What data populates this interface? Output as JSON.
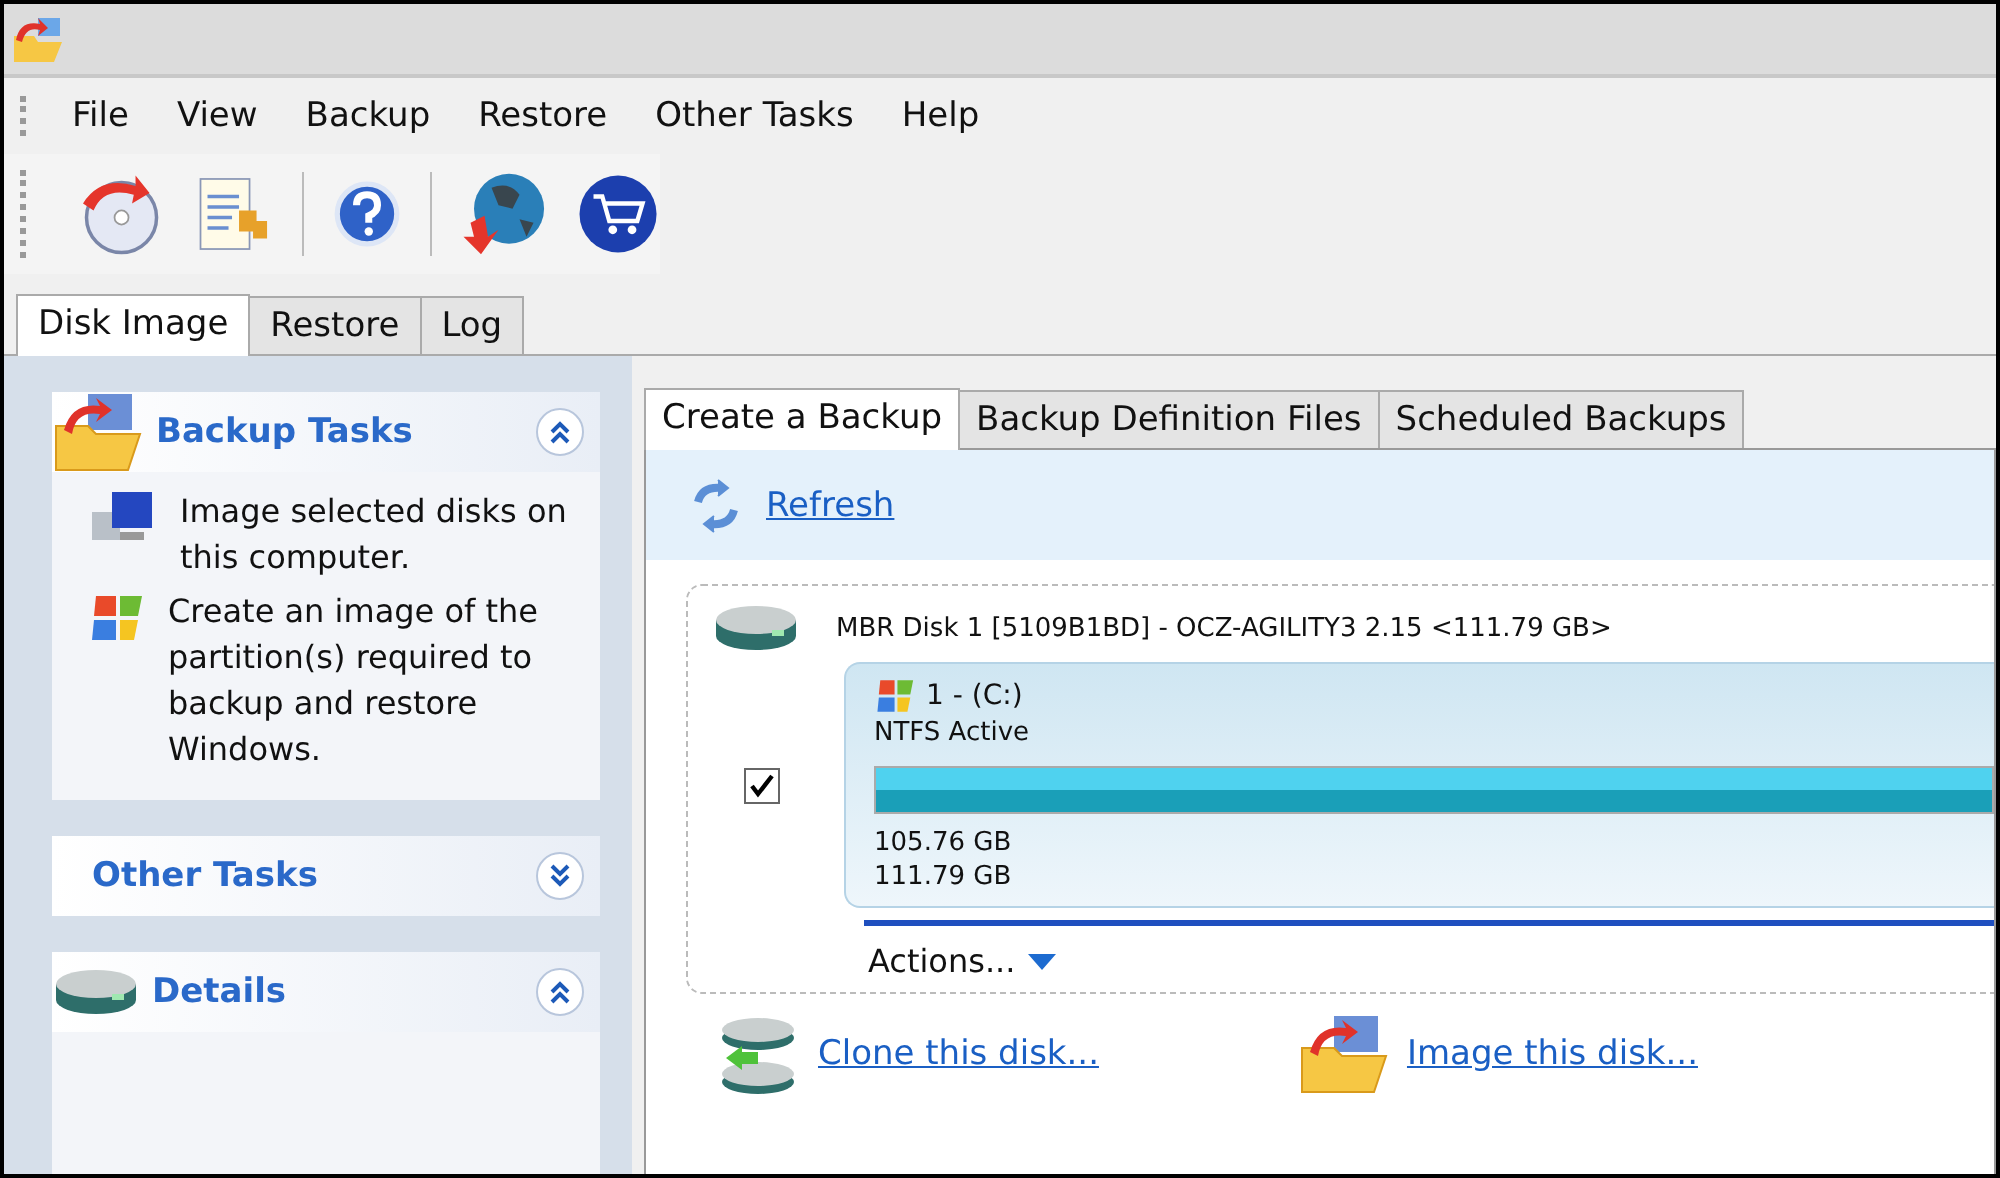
{
  "menu": [
    "File",
    "View",
    "Backup",
    "Restore",
    "Other Tasks",
    "Help"
  ],
  "toolbar": [
    {
      "kind": "disc"
    },
    {
      "kind": "notepad"
    },
    {
      "kind": "sep"
    },
    {
      "kind": "help"
    },
    {
      "kind": "sep"
    },
    {
      "kind": "globe"
    },
    {
      "kind": "cart"
    }
  ],
  "main_tabs": [
    {
      "label": "Disk Image",
      "selected": true
    },
    {
      "label": "Restore",
      "selected": false
    },
    {
      "label": "Log",
      "selected": false
    }
  ],
  "sidebar": [
    {
      "kind": "backup",
      "title": "Backup Tasks",
      "expanded": true,
      "items": [
        {
          "kind": "computer",
          "text": "Image selected disks on this computer."
        },
        {
          "kind": "windows",
          "text": "Create an image of the partition(s) required to backup and restore Windows."
        }
      ]
    },
    {
      "kind": "none",
      "title": "Other Tasks",
      "expanded": false
    },
    {
      "kind": "disk",
      "title": "Details",
      "expanded": true
    }
  ],
  "sub_tabs": [
    {
      "label": "Create a Backup",
      "selected": true
    },
    {
      "label": "Backup Definition Files",
      "selected": false
    },
    {
      "label": "Scheduled Backups",
      "selected": false
    }
  ],
  "refresh": "Refresh",
  "disk": {
    "title": "MBR Disk 1 [5109B1BD] - OCZ-AGILITY3 2.15  <111.79 GB>",
    "partition": {
      "checked": true,
      "name": "1 -  (C:)",
      "fs": "NTFS Active",
      "level": 1,
      "used": "105.76 GB",
      "total": "111.79 GB"
    },
    "actions": "Actions..."
  },
  "links": [
    {
      "kind": "clone",
      "text": "Clone this disk..."
    },
    {
      "kind": "image",
      "text": "Image this disk..."
    }
  ]
}
